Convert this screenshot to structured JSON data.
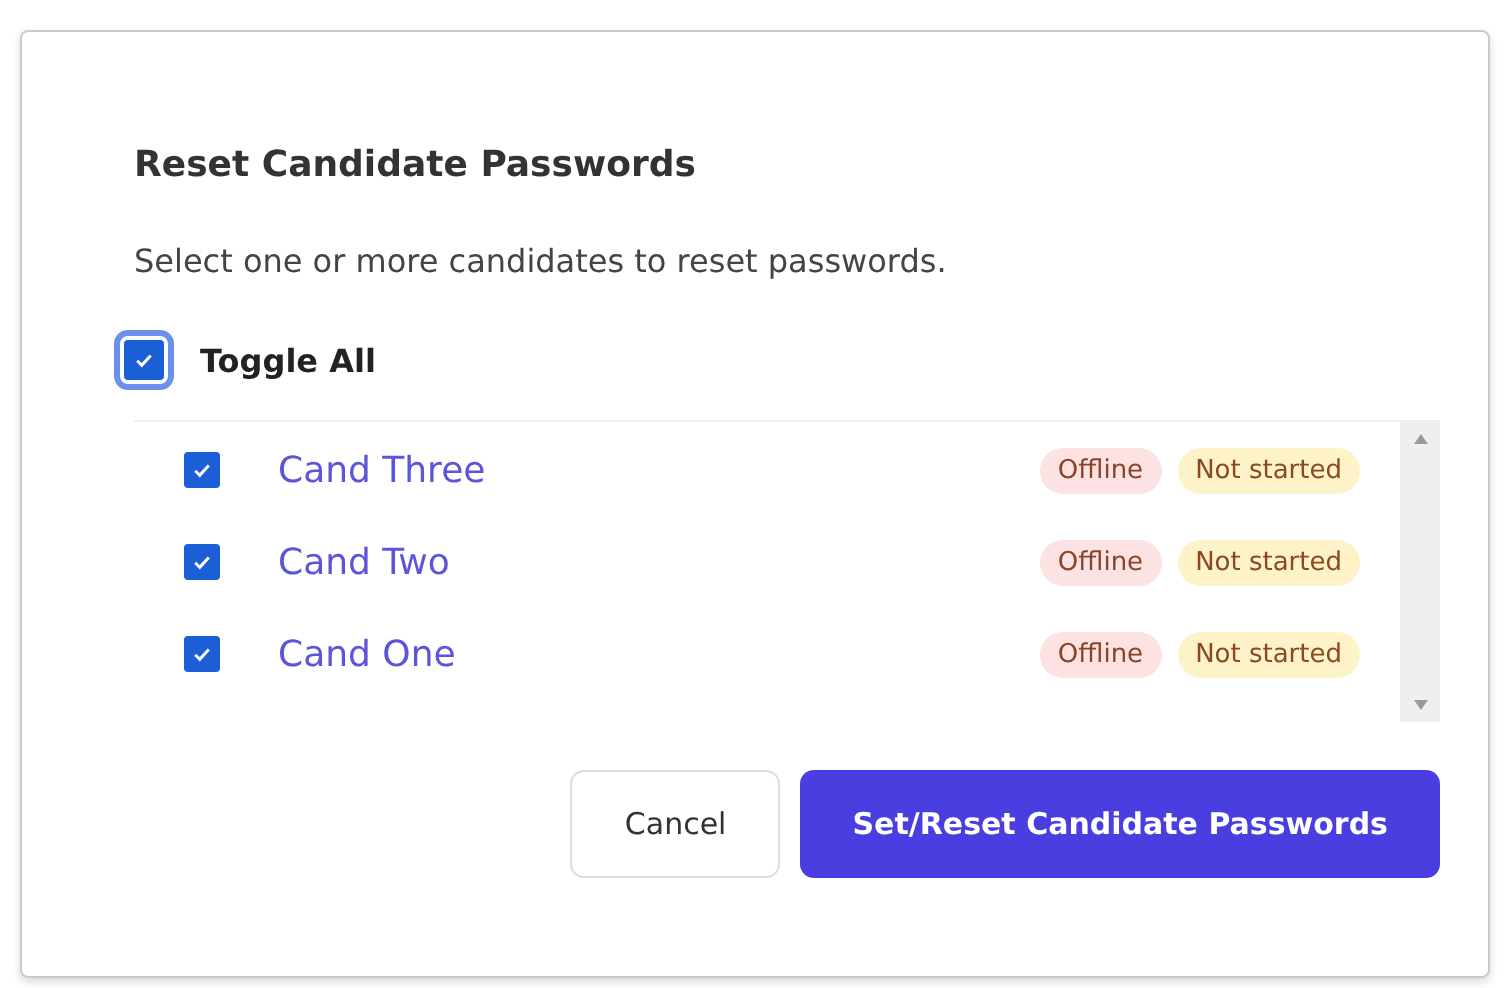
{
  "dialog": {
    "title": "Reset Candidate Passwords",
    "description": "Select one or more candidates to reset passwords.",
    "toggle_all": {
      "label": "Toggle All",
      "checked": true,
      "focused": true
    },
    "candidates": [
      {
        "name": "Cand Three",
        "checked": true,
        "badges": [
          {
            "text": "Offline",
            "color": "#fde2e4"
          },
          {
            "text": "Not started",
            "color": "#fdf2c8"
          }
        ]
      },
      {
        "name": "Cand Two",
        "checked": true,
        "badges": [
          {
            "text": "Offline",
            "color": "#fde2e4"
          },
          {
            "text": "Not started",
            "color": "#fdf2c8"
          }
        ]
      },
      {
        "name": "Cand One",
        "checked": true,
        "badges": [
          {
            "text": "Offline",
            "color": "#fde2e4"
          },
          {
            "text": "Not started",
            "color": "#fdf2c8"
          }
        ]
      }
    ],
    "buttons": [
      {
        "label": "Cancel",
        "kind": "secondary"
      },
      {
        "label": "Set/Reset Candidate Passwords",
        "kind": "primary"
      }
    ]
  }
}
